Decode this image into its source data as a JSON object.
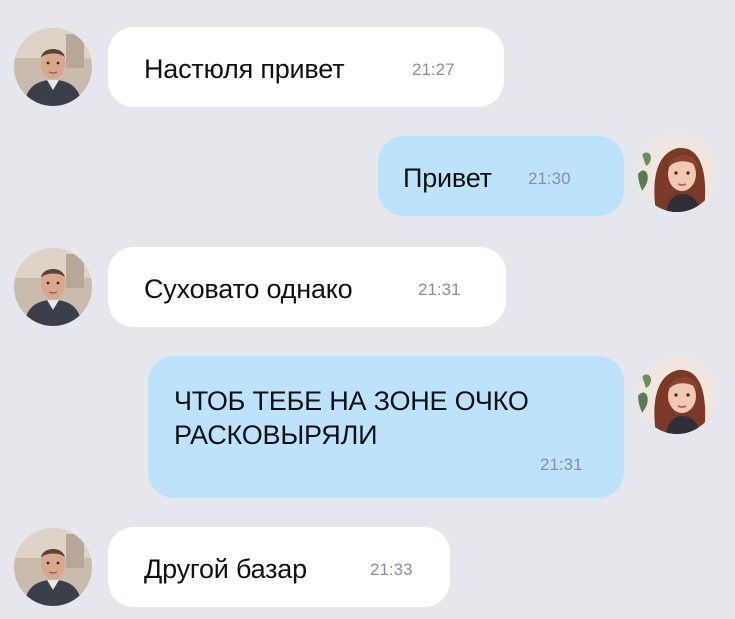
{
  "messages": [
    {
      "side": "incoming",
      "text": "Настюля привет",
      "time": "21:27"
    },
    {
      "side": "outgoing",
      "text": "Привет",
      "time": "21:30"
    },
    {
      "side": "incoming",
      "text": "Суховато однако",
      "time": "21:31"
    },
    {
      "side": "outgoing",
      "text_lines": [
        "ЧТОБ ТЕБЕ НА ЗОНЕ ОЧКО",
        "РАСКОВЫРЯЛИ"
      ],
      "time": "21:31"
    },
    {
      "side": "incoming",
      "text": "Другой базар",
      "time": "21:33"
    }
  ],
  "colors": {
    "background": "#e6e7ec",
    "incoming_bubble": "#ffffff",
    "outgoing_bubble": "#bde2fb",
    "time_text": "#8c9096"
  },
  "icons": {
    "incoming_avatar": "man-avatar",
    "outgoing_avatar": "woman-avatar"
  }
}
